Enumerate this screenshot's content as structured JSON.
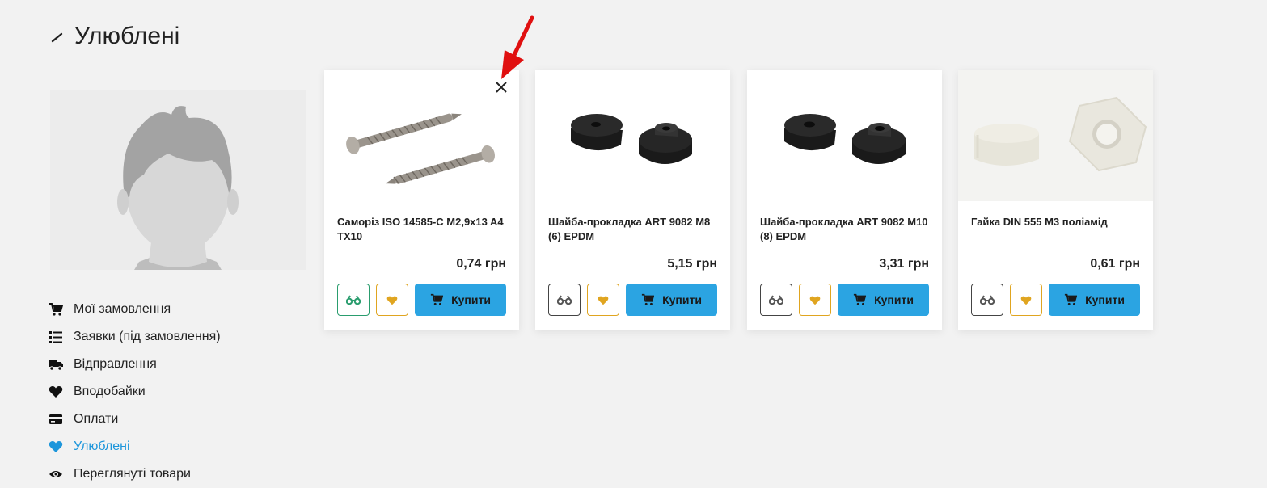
{
  "page": {
    "title": "Улюблені"
  },
  "menu": [
    {
      "label": "Мої замовлення",
      "icon": "cart-icon"
    },
    {
      "label": "Заявки (під замовлення)",
      "icon": "list-icon"
    },
    {
      "label": "Відправлення",
      "icon": "truck-icon"
    },
    {
      "label": "Вподобайки",
      "icon": "heart-icon"
    },
    {
      "label": "Оплати",
      "icon": "credit-card-icon"
    },
    {
      "label": "Улюблені",
      "icon": "heart-icon",
      "active": true
    },
    {
      "label": "Переглянуті товари",
      "icon": "eye-icon"
    }
  ],
  "products": [
    {
      "name": "Саморіз ISO 14585-C M2,9x13 A4 TX10",
      "price": "0,74 грн",
      "buy_label": "Купити"
    },
    {
      "name": "Шайба-прокладка ART 9082 M8 (6) EPDM",
      "price": "5,15 грн",
      "buy_label": "Купити"
    },
    {
      "name": "Шайба-прокладка ART 9082 M10 (8) EPDM",
      "price": "3,31 грн",
      "buy_label": "Купити"
    },
    {
      "name": "Гайка DIN 555 M3 поліамід",
      "price": "0,61 грн",
      "buy_label": "Купити"
    }
  ],
  "colors": {
    "accent": "#1d96db",
    "buy": "#2ba4e2",
    "fav": "#e0a520",
    "compare_active": "#2a9d6e",
    "annotation": "#e01010"
  }
}
